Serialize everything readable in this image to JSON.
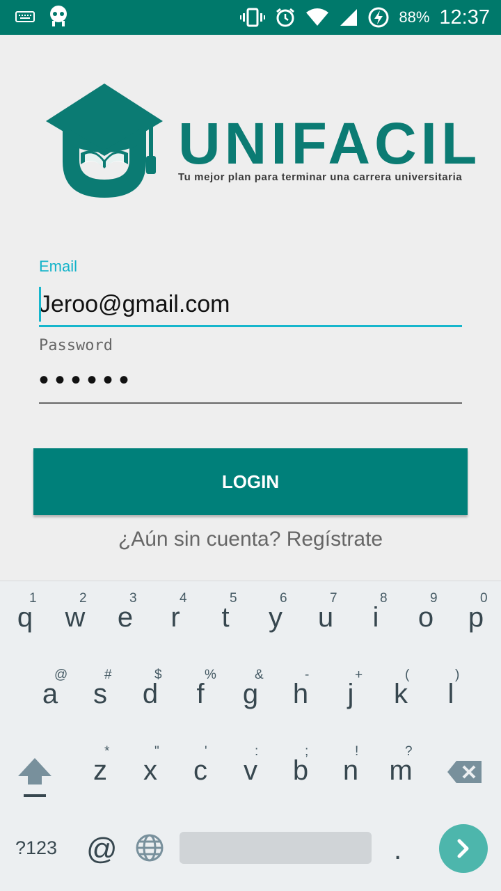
{
  "status_bar": {
    "battery": "88%",
    "time": "12:37",
    "icons": [
      "keyboard-icon",
      "android-robot-icon",
      "vibrate-icon",
      "alarm-icon",
      "wifi-icon",
      "signal-icon",
      "battery-charging-icon"
    ]
  },
  "logo": {
    "wordmark": "UNIFACIL",
    "tagline": "Tu mejor plan para terminar una carrera universitaria",
    "brand_color": "#0b7b73"
  },
  "form": {
    "email_label": "Email",
    "email_value": "Jeroo@gmail.com",
    "password_label": "Password",
    "password_value": "••••••",
    "login_label": "LOGIN",
    "register_link": "¿Aún sin cuenta? Regístrate"
  },
  "keyboard": {
    "row1": [
      {
        "key": "q",
        "hint": "1"
      },
      {
        "key": "w",
        "hint": "2"
      },
      {
        "key": "e",
        "hint": "3"
      },
      {
        "key": "r",
        "hint": "4"
      },
      {
        "key": "t",
        "hint": "5"
      },
      {
        "key": "y",
        "hint": "6"
      },
      {
        "key": "u",
        "hint": "7"
      },
      {
        "key": "i",
        "hint": "8"
      },
      {
        "key": "o",
        "hint": "9"
      },
      {
        "key": "p",
        "hint": "0"
      }
    ],
    "row2": [
      {
        "key": "a",
        "hint": "@"
      },
      {
        "key": "s",
        "hint": "#"
      },
      {
        "key": "d",
        "hint": "$"
      },
      {
        "key": "f",
        "hint": "%"
      },
      {
        "key": "g",
        "hint": "&"
      },
      {
        "key": "h",
        "hint": "-"
      },
      {
        "key": "j",
        "hint": "+"
      },
      {
        "key": "k",
        "hint": "("
      },
      {
        "key": "l",
        "hint": ")"
      }
    ],
    "row3": [
      {
        "key": "z",
        "hint": "*"
      },
      {
        "key": "x",
        "hint": "\""
      },
      {
        "key": "c",
        "hint": "'"
      },
      {
        "key": "v",
        "hint": ":"
      },
      {
        "key": "b",
        "hint": ";"
      },
      {
        "key": "n",
        "hint": "!"
      },
      {
        "key": "m",
        "hint": "?"
      }
    ],
    "symbols_label": "?123",
    "at_label": "@",
    "period_label": "."
  },
  "colors": {
    "accent": "#00796b",
    "button": "#00807a",
    "focus": "#16b6cc",
    "go_key": "#4db6ac"
  }
}
